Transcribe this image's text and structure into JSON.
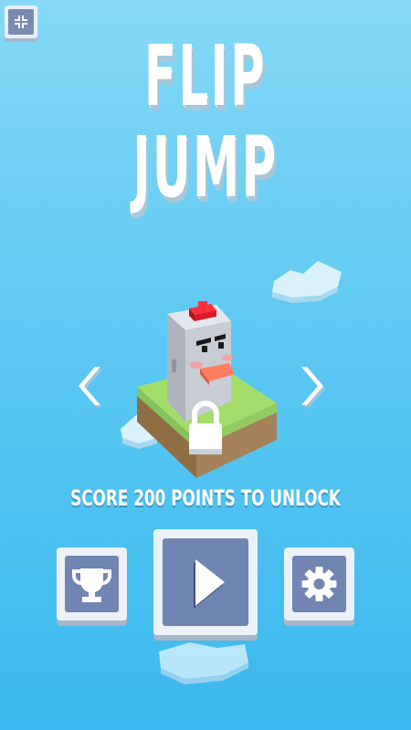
{
  "title": {
    "line1": "FLIP",
    "line2": "JUMP"
  },
  "character": {
    "locked": true,
    "unlock_message": "SCORE 200 POINTS TO UNLOCK"
  },
  "buttons": {
    "exit_fullscreen_icon": "compress-arrows-icon",
    "prev_icon": "chevron-left-icon",
    "next_icon": "chevron-right-icon",
    "leaderboard_icon": "trophy-icon",
    "play_icon": "play-icon",
    "settings_icon": "gear-icon"
  },
  "colors": {
    "sky": "#5ec9f2",
    "button_face": "#7085b1",
    "button_frame": "#ecf1f8",
    "grass": "#9bd468",
    "accent_red": "#d9182b"
  }
}
